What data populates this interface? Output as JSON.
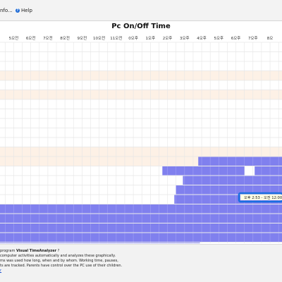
{
  "menu": {
    "info_label": "nfo...",
    "help_label": "Help",
    "help_icon": "help-circle-icon"
  },
  "chart_data": {
    "type": "gantt",
    "title": "Pc On/Off Time",
    "time_labels": [
      "5오전",
      "6오전",
      "7오전",
      "8오전",
      "9오전",
      "10오전",
      "11오전",
      "0오후",
      "1오후",
      "2오후",
      "3오후",
      "4오후",
      "5오후",
      "6오후",
      "7오후",
      "8오"
    ],
    "x_range_hours": [
      4.2,
      20.7
    ],
    "row_count": 21,
    "bars": [
      {
        "row": 13,
        "start": 15.8,
        "end": 20.7
      },
      {
        "row": 14,
        "start": 13.7,
        "end": 18.5
      },
      {
        "row": 14,
        "start": 19.1,
        "end": 20.7
      },
      {
        "row": 15,
        "start": 14.9,
        "end": 20.7
      },
      {
        "row": 16,
        "start": 14.5,
        "end": 20.7
      },
      {
        "row": 17,
        "start": 14.4,
        "end": 20.7
      },
      {
        "row": 18,
        "start": 4.2,
        "end": 20.7
      },
      {
        "row": 19,
        "start": 4.2,
        "end": 20.7
      },
      {
        "row": 20,
        "start": 4.2,
        "end": 20.7
      },
      {
        "row": 21,
        "start": 4.2,
        "end": 20.7
      },
      {
        "row": 22,
        "start": 4.2,
        "end": 15.9
      }
    ],
    "tooltip": {
      "text": "오후 2:53 - 오전 12:00"
    },
    "colors": {
      "bar": "#8080ee",
      "bar_light": "#a0a0f4",
      "band": "#fdf1e6",
      "tooltip_border": "#1a6fe0",
      "grid": "#e6e6e6"
    }
  },
  "info": {
    "line1_prefix": "program ",
    "line1_name": "Visual TimeAnalyzer",
    "line1_suffix": " ?",
    "line2": "computer activities automatically and analyzes these graphically.",
    "line3": "ms was used how long, when and by whom. Working time, pauses,",
    "line4": "ts are tracked. Parents have control over the PC use of their children.",
    "link": "r"
  }
}
